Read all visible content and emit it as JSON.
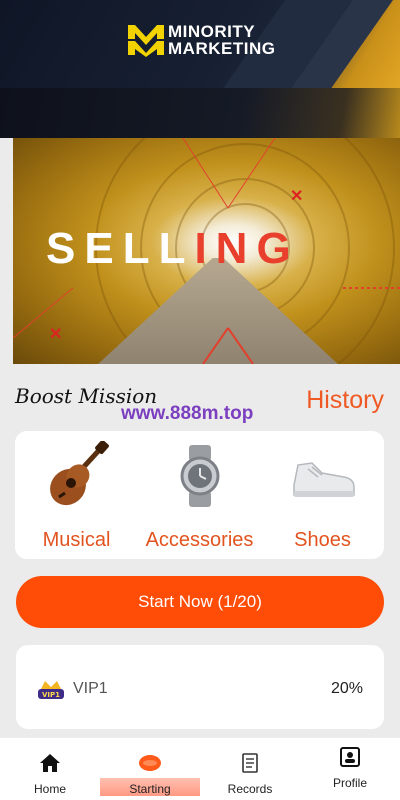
{
  "brand": {
    "line1": "MINORITY",
    "line2": "MARKETING",
    "accent": "#f2d300"
  },
  "banner": {
    "text_white": "SELL",
    "text_red": "ING"
  },
  "mission": {
    "title": "Boost Mission",
    "watermark": "www.888m.top",
    "history_link": "History"
  },
  "categories": [
    {
      "label": "Musical",
      "icon": "ukulele-icon"
    },
    {
      "label": "Accessories",
      "icon": "watch-icon"
    },
    {
      "label": "Shoes",
      "icon": "sneaker-icon"
    }
  ],
  "start_button": {
    "label": "Start Now  (1/20)"
  },
  "vip": {
    "badge_text": "VIP1",
    "name": "VIP1",
    "rate": "20%"
  },
  "nav": [
    {
      "label": "Home",
      "icon": "home-icon"
    },
    {
      "label": "Starting",
      "icon": "starting-icon",
      "active": true
    },
    {
      "label": "Records",
      "icon": "records-icon"
    },
    {
      "label": "Profile",
      "icon": "profile-icon"
    }
  ],
  "colors": {
    "primary": "#ff4c06",
    "accent_text": "#e2541f",
    "watermark": "#7b3fbf"
  }
}
